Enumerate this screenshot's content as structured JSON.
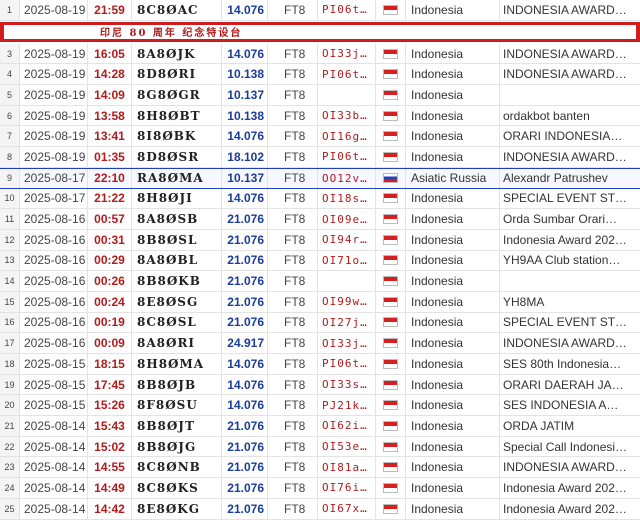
{
  "banner": {
    "text": "印尼 80 周年 纪念特设台"
  },
  "rows": [
    {
      "num": "1",
      "date": "2025-08-19",
      "time": "21:59",
      "call": "8C8ØAC",
      "freq": "14.076",
      "mode": "FT8",
      "qsl": "PI06t…",
      "flag": "id",
      "country": "Indonesia",
      "name": "INDONESIA AWARD…"
    },
    {
      "num": "3",
      "date": "2025-08-19",
      "time": "16:05",
      "call": "8A8ØJK",
      "freq": "14.076",
      "mode": "FT8",
      "qsl": "OI33j…",
      "flag": "id",
      "country": "Indonesia",
      "name": "INDONESIA AWARD…"
    },
    {
      "num": "4",
      "date": "2025-08-19",
      "time": "14:28",
      "call": "8D8ØRI",
      "freq": "10.138",
      "mode": "FT8",
      "qsl": "PI06t…",
      "flag": "id",
      "country": "Indonesia",
      "name": "INDONESIA AWARD…"
    },
    {
      "num": "5",
      "date": "2025-08-19",
      "time": "14:09",
      "call": "8G8ØGR",
      "freq": "10.137",
      "mode": "FT8",
      "qsl": "",
      "flag": "id",
      "country": "Indonesia",
      "name": ""
    },
    {
      "num": "6",
      "date": "2025-08-19",
      "time": "13:58",
      "call": "8H8ØBT",
      "freq": "10.138",
      "mode": "FT8",
      "qsl": "OI33b…",
      "flag": "id",
      "country": "Indonesia",
      "name": "ordakbot banten"
    },
    {
      "num": "7",
      "date": "2025-08-19",
      "time": "13:41",
      "call": "8I8ØBK",
      "freq": "14.076",
      "mode": "FT8",
      "qsl": "OI16g…",
      "flag": "id",
      "country": "Indonesia",
      "name": "ORARI INDONESIA…"
    },
    {
      "num": "8",
      "date": "2025-08-19",
      "time": "01:35",
      "call": "8D8ØSR",
      "freq": "18.102",
      "mode": "FT8",
      "qsl": "PI06t…",
      "flag": "id",
      "country": "Indonesia",
      "name": "INDONESIA AWARD…"
    },
    {
      "num": "9",
      "date": "2025-08-17",
      "time": "22:10",
      "call": "RA8ØMA",
      "freq": "10.137",
      "mode": "FT8",
      "qsl": "OO12v…",
      "flag": "ru",
      "country": "Asiatic Russia",
      "name": "Alexandr Patrushev"
    },
    {
      "num": "10",
      "date": "2025-08-17",
      "time": "21:22",
      "call": "8H8ØJI",
      "freq": "14.076",
      "mode": "FT8",
      "qsl": "OI18s…",
      "flag": "id",
      "country": "Indonesia",
      "name": "SPECIAL EVENT ST…"
    },
    {
      "num": "11",
      "date": "2025-08-16",
      "time": "00:57",
      "call": "8A8ØSB",
      "freq": "21.076",
      "mode": "FT8",
      "qsl": "OI09e…",
      "flag": "id",
      "country": "Indonesia",
      "name": "Orda Sumbar Orari…"
    },
    {
      "num": "12",
      "date": "2025-08-16",
      "time": "00:31",
      "call": "8B8ØSL",
      "freq": "21.076",
      "mode": "FT8",
      "qsl": "OI94r…",
      "flag": "id",
      "country": "Indonesia",
      "name": "Indonesia Award 202…"
    },
    {
      "num": "13",
      "date": "2025-08-16",
      "time": "00:29",
      "call": "8A8ØBL",
      "freq": "21.076",
      "mode": "FT8",
      "qsl": "OI71o…",
      "flag": "id",
      "country": "Indonesia",
      "name": "YH9AA Club station…"
    },
    {
      "num": "14",
      "date": "2025-08-16",
      "time": "00:26",
      "call": "8B8ØKB",
      "freq": "21.076",
      "mode": "FT8",
      "qsl": "",
      "flag": "id",
      "country": "Indonesia",
      "name": ""
    },
    {
      "num": "15",
      "date": "2025-08-16",
      "time": "00:24",
      "call": "8E8ØSG",
      "freq": "21.076",
      "mode": "FT8",
      "qsl": "OI99w…",
      "flag": "id",
      "country": "Indonesia",
      "name": "YH8MA"
    },
    {
      "num": "16",
      "date": "2025-08-16",
      "time": "00:19",
      "call": "8C8ØSL",
      "freq": "21.076",
      "mode": "FT8",
      "qsl": "OI27j…",
      "flag": "id",
      "country": "Indonesia",
      "name": "SPECIAL EVENT ST…"
    },
    {
      "num": "17",
      "date": "2025-08-16",
      "time": "00:09",
      "call": "8A8ØRI",
      "freq": "24.917",
      "mode": "FT8",
      "qsl": "OI33j…",
      "flag": "id",
      "country": "Indonesia",
      "name": "INDONESIA AWARD…"
    },
    {
      "num": "18",
      "date": "2025-08-15",
      "time": "18:15",
      "call": "8H8ØMA",
      "freq": "14.076",
      "mode": "FT8",
      "qsl": "PI06t…",
      "flag": "id",
      "country": "Indonesia",
      "name": "SES 80th Indonesia…"
    },
    {
      "num": "19",
      "date": "2025-08-15",
      "time": "17:45",
      "call": "8B8ØJB",
      "freq": "14.076",
      "mode": "FT8",
      "qsl": "OI33s…",
      "flag": "id",
      "country": "Indonesia",
      "name": "ORARI DAERAH JA…"
    },
    {
      "num": "20",
      "date": "2025-08-15",
      "time": "15:26",
      "call": "8F8ØSU",
      "freq": "14.076",
      "mode": "FT8",
      "qsl": "PJ21k…",
      "flag": "id",
      "country": "Indonesia",
      "name": "SES INDONESIA A…"
    },
    {
      "num": "21",
      "date": "2025-08-14",
      "time": "15:43",
      "call": "8B8ØJT",
      "freq": "21.076",
      "mode": "FT8",
      "qsl": "OI62i…",
      "flag": "id",
      "country": "Indonesia",
      "name": "ORDA JATIM"
    },
    {
      "num": "22",
      "date": "2025-08-14",
      "time": "15:02",
      "call": "8B8ØJG",
      "freq": "21.076",
      "mode": "FT8",
      "qsl": "OI53e…",
      "flag": "id",
      "country": "Indonesia",
      "name": "Special Call Indonesi…"
    },
    {
      "num": "23",
      "date": "2025-08-14",
      "time": "14:55",
      "call": "8C8ØNB",
      "freq": "21.076",
      "mode": "FT8",
      "qsl": "OI81a…",
      "flag": "id",
      "country": "Indonesia",
      "name": "INDONESIA AWARD…"
    },
    {
      "num": "24",
      "date": "2025-08-14",
      "time": "14:49",
      "call": "8C8ØKS",
      "freq": "21.076",
      "mode": "FT8",
      "qsl": "OI76i…",
      "flag": "id",
      "country": "Indonesia",
      "name": "Indonesia Award 202…"
    },
    {
      "num": "25",
      "date": "2025-08-14",
      "time": "14:42",
      "call": "8E8ØKG",
      "freq": "21.076",
      "mode": "FT8",
      "qsl": "OI67x…",
      "flag": "id",
      "country": "Indonesia",
      "name": "Indonesia Award 202…"
    }
  ],
  "selected_row": "9",
  "colors": {
    "time": "#b01c1c",
    "freq": "#1a3c9a",
    "banner_border": "#d01c1c",
    "selection": "#1f3fbf"
  }
}
